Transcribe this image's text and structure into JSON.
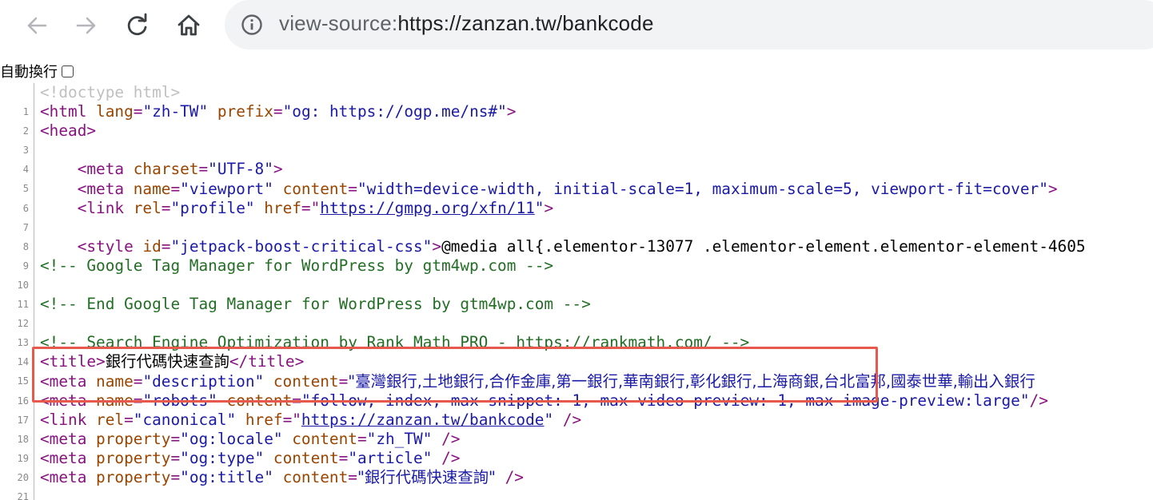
{
  "browser": {
    "back_icon": "arrow-left-icon",
    "forward_icon": "arrow-right-icon",
    "reload_icon": "reload-icon",
    "home_icon": "home-icon",
    "info_icon": "info-icon",
    "url_scheme": "view-source:",
    "url_rest": "https://zanzan.tw/bankcode"
  },
  "wrap_toggle": {
    "label": "自動換行",
    "checked": false
  },
  "source": {
    "lines": [
      {
        "n": "1"
      },
      {
        "n": "2"
      },
      {
        "n": "3"
      },
      {
        "n": "4"
      },
      {
        "n": "5"
      },
      {
        "n": "6"
      },
      {
        "n": "7"
      },
      {
        "n": "8"
      },
      {
        "n": "9"
      },
      {
        "n": "10"
      },
      {
        "n": "11"
      },
      {
        "n": "12"
      },
      {
        "n": "13"
      },
      {
        "n": "14"
      },
      {
        "n": "15"
      },
      {
        "n": "16"
      },
      {
        "n": "17"
      },
      {
        "n": "18"
      },
      {
        "n": "19"
      },
      {
        "n": "20"
      },
      {
        "n": "21"
      }
    ],
    "l1": "<!doctype html>",
    "l2": {
      "t1": "<html ",
      "a1": "lang",
      "e1": "=",
      "v1": "\"zh-TW\"",
      "a2": " prefix",
      "e2": "=",
      "v2": "\"og: https://ogp.me/ns#\"",
      "t2": ">"
    },
    "l3": "<head>",
    "l5": {
      "t1": "<meta ",
      "a1": "charset",
      "e1": "=",
      "v1": "\"UTF-8\"",
      "t2": ">"
    },
    "l6": {
      "t1": "<meta ",
      "a1": "name",
      "e1": "=",
      "v1": "\"viewport\"",
      "a2": " content",
      "e2": "=",
      "v2": "\"width=device-width, initial-scale=1, maximum-scale=5, viewport-fit=cover\"",
      "t2": ">"
    },
    "l7": {
      "t1": "<link ",
      "a1": "rel",
      "e1": "=",
      "v1": "\"profile\"",
      "a2": " href",
      "e2": "=\"",
      "link": "https://gmpg.org/xfn/11",
      "v2": "\"",
      "t2": ">"
    },
    "l9": {
      "t1": "<style ",
      "a1": "id",
      "e1": "=",
      "v1": "\"jetpack-boost-critical-css\"",
      "t2": ">",
      "text": "@media all{.elementor-13077 .elementor-element.elementor-element-4605"
    },
    "l10": "<!-- Google Tag Manager for WordPress by gtm4wp.com -->",
    "l12": "<!-- End Google Tag Manager for WordPress by gtm4wp.com -->",
    "l14": "<!-- Search Engine Optimization by Rank Math PRO - https://rankmath.com/ -->",
    "l15": {
      "t1": "<title>",
      "text": "銀行代碼快速查詢",
      "t2": "</title>"
    },
    "l16": {
      "t1": "<meta ",
      "a1": "name",
      "e1": "=",
      "v1": "\"description\"",
      "a2": " content",
      "e2": "=",
      "v2": "\"臺灣銀行,土地銀行,合作金庫,第一銀行,華南銀行,彰化銀行,上海商銀,台北富邦,國泰世華,輸出入銀行"
    },
    "l17": {
      "t1": "<meta ",
      "a1": "name",
      "e1": "=",
      "v1": "\"robots\"",
      "a2": " content",
      "e2": "=",
      "v2": "\"follow, index, max-snippet:-1, max-video-preview:-1, max-image-preview:large\"",
      "t2": "/>"
    },
    "l18": {
      "t1": "<link ",
      "a1": "rel",
      "e1": "=",
      "v1": "\"canonical\"",
      "a2": " href",
      "e2": "=\"",
      "link": "https://zanzan.tw/bankcode",
      "v2": "\"",
      "t2": " />"
    },
    "l19": {
      "t1": "<meta ",
      "a1": "property",
      "e1": "=",
      "v1": "\"og:locale\"",
      "a2": " content",
      "e2": "=",
      "v2": "\"zh_TW\"",
      "t2": " />"
    },
    "l20": {
      "t1": "<meta ",
      "a1": "property",
      "e1": "=",
      "v1": "\"og:type\"",
      "a2": " content",
      "e2": "=",
      "v2": "\"article\"",
      "t2": " />"
    },
    "l21": {
      "t1": "<meta ",
      "a1": "property",
      "e1": "=",
      "v1": "\"og:title\"",
      "a2": " content",
      "e2": "=",
      "v2": "\"銀行代碼快速查詢\"",
      "t2": " />"
    }
  },
  "colors": {
    "tag": "#881280",
    "attr": "#994500",
    "value": "#1a1aa6",
    "comment": "#236e25",
    "highlight_border": "#e8594d"
  }
}
